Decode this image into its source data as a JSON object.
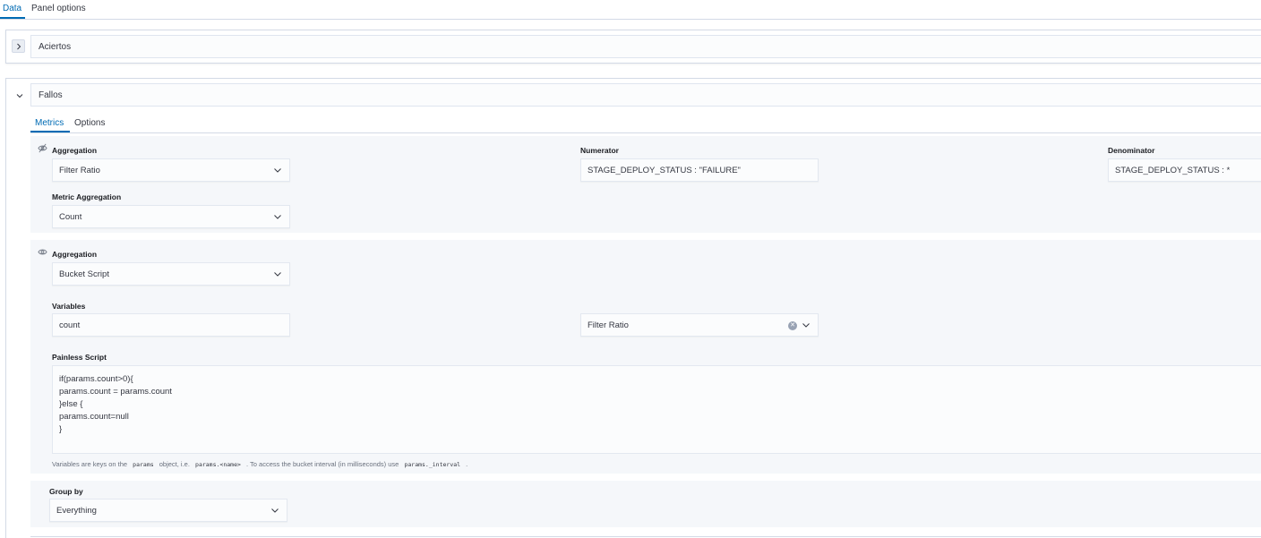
{
  "tabs": [
    {
      "label": "Data",
      "active": true
    },
    {
      "label": "Panel options",
      "active": false
    }
  ],
  "series": [
    {
      "label": "Aciertos",
      "expanded": false
    },
    {
      "label": "Fallos",
      "expanded": true,
      "tabs": [
        {
          "label": "Metrics",
          "active": true
        },
        {
          "label": "Options",
          "active": false
        }
      ],
      "metrics": [
        {
          "aggregation_label": "Aggregation",
          "aggregation_value": "Filter Ratio",
          "numerator_label": "Numerator",
          "numerator_value": "STAGE_DEPLOY_STATUS : \"FAILURE\"",
          "denominator_label": "Denominator",
          "denominator_value": "STAGE_DEPLOY_STATUS : *",
          "metric_aggregation_label": "Metric Aggregation",
          "metric_aggregation_value": "Count"
        },
        {
          "aggregation_label": "Aggregation",
          "aggregation_value": "Bucket Script",
          "variables_label": "Variables",
          "variable_name": "count",
          "variable_metric": "Filter Ratio",
          "script_label": "Painless Script",
          "script_lines": [
            "if(params.count>0){",
            "params.count = params.count",
            "}else {",
            "params.count=null",
            "}"
          ],
          "help": {
            "part1": "Variables are keys on the",
            "code1": "params",
            "part2": "object, i.e.",
            "code2": "params.<name>",
            "part3": ". To access the bucket interval (in milliseconds) use",
            "code3": "params._interval",
            "part4": "."
          }
        }
      ],
      "group_by_label": "Group by",
      "group_by_value": "Everything"
    }
  ],
  "colors": {
    "accent": "#006bb4",
    "border": "#d3dae6",
    "block_bg": "#f5f7fa"
  }
}
